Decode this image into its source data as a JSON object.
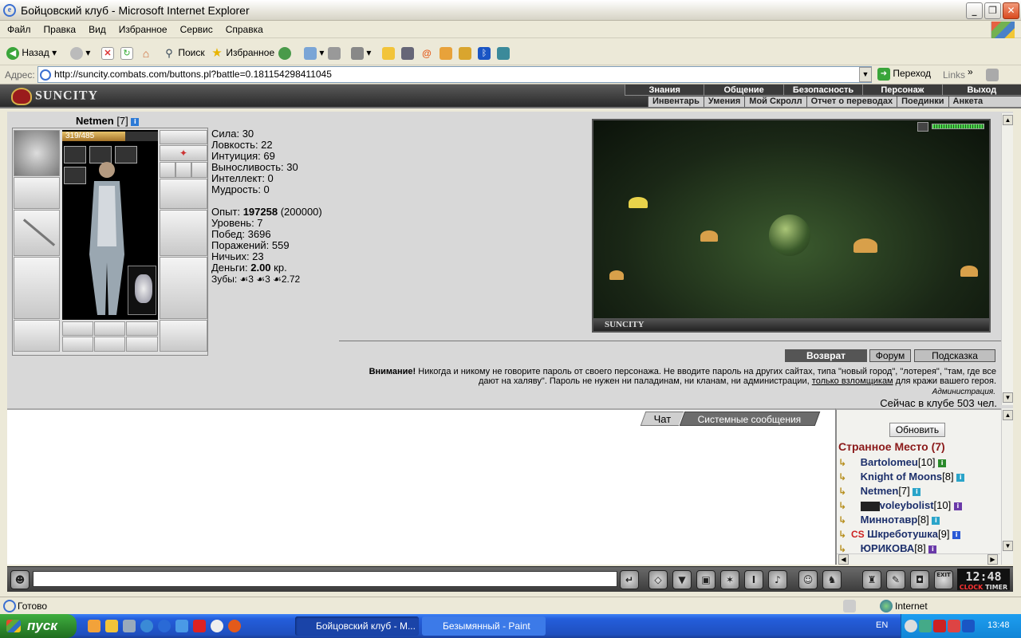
{
  "window": {
    "title": "Бойцовский клуб - Microsoft Internet Explorer",
    "minimize": "_",
    "maximize": "❐",
    "close": "✕"
  },
  "menu": [
    "Файл",
    "Правка",
    "Вид",
    "Избранное",
    "Сервис",
    "Справка"
  ],
  "toolbar": {
    "back": "Назад",
    "search": "Поиск",
    "favorites": "Избранное"
  },
  "address": {
    "label": "Адрес:",
    "url": "http://suncity.combats.com/buttons.pl?battle=0.181154298411045",
    "go": "Переход",
    "links": "Links"
  },
  "game": {
    "logo": "SUNCITY",
    "nav_top": [
      "Знания",
      "Общение",
      "Безопасность",
      "Персонаж",
      "Выход"
    ],
    "nav_sub": [
      "Инвентарь",
      "Умения",
      "Мой Скролл",
      "Отчет о переводах",
      "Поединки",
      "Анкета"
    ]
  },
  "character": {
    "name": "Netmen",
    "level": "[7]",
    "hp": "319/485",
    "hp_fraction": 0.66,
    "stats": [
      "Сила: 30",
      "Ловкость: 22",
      "Интуиция: 69",
      "Выносливость: 30",
      "Интеллект: 0",
      "Мудрость: 0"
    ],
    "exp_label": "Опыт:",
    "exp_value": "197258",
    "exp_next": "(200000)",
    "level_line": "Уровень: 7",
    "wins": "Побед: 3696",
    "losses": "Поражений: 559",
    "draws": "Ничьих: 23",
    "money_label": "Деньги:",
    "money_value": "2.00",
    "money_unit": "кр.",
    "teeth": "Зубы: ☙3 ☙3 ☙2.72"
  },
  "scene": {
    "brand": "SUNCITY"
  },
  "buttons": {
    "return": "Возврат",
    "forum": "Форум",
    "hint": "Подсказка"
  },
  "warning": {
    "bold": "Внимание!",
    "text1": " Никогда и никому не говорите пароль от своего персонажа. Не вводите пароль на других сайтах, типа \"новый город\", \"лотерея\", \"там, где все дают на халяву\". Пароль не нужен ни паладинам, ни кланам, ни администрации, ",
    "link": "только взломщикам",
    "text2": " для кражи вашего героя.",
    "admin": "Администрация."
  },
  "online": "Сейчас в клубе 503 чел.",
  "chat": {
    "tab_chat": "Чат",
    "tab_system": "Системные сообщения"
  },
  "users": {
    "refresh": "Обновить",
    "room": "Странное Место (7)",
    "list": [
      {
        "name": "Bartolomeu",
        "level": "[10]"
      },
      {
        "name": "Knight of Moons",
        "level": "[8]"
      },
      {
        "name": "Netmen",
        "level": "[7]"
      },
      {
        "name": "voleybolist",
        "level": "[10]"
      },
      {
        "name": "Миннотавр",
        "level": "[8]"
      },
      {
        "name": "Шкреботушка",
        "level": "[9]",
        "clan": "CS"
      },
      {
        "name": "ЮРИКОВА",
        "level": "[8]"
      }
    ]
  },
  "clock": {
    "time": "12:48",
    "label_clock": "CLOCK",
    "label_timer": "TIMER",
    "exit": "EXIT"
  },
  "status": {
    "text": "Готово",
    "zone": "Internet"
  },
  "taskbar": {
    "start": "пуск",
    "task1": "Бойцовский клуб - M...",
    "task2": "Безымянный - Paint",
    "lang": "EN",
    "time": "13:48"
  },
  "colors": {
    "room_title": "#8b1a1a",
    "user_name": "#1c2f6b",
    "taskbar": "#245edb"
  }
}
